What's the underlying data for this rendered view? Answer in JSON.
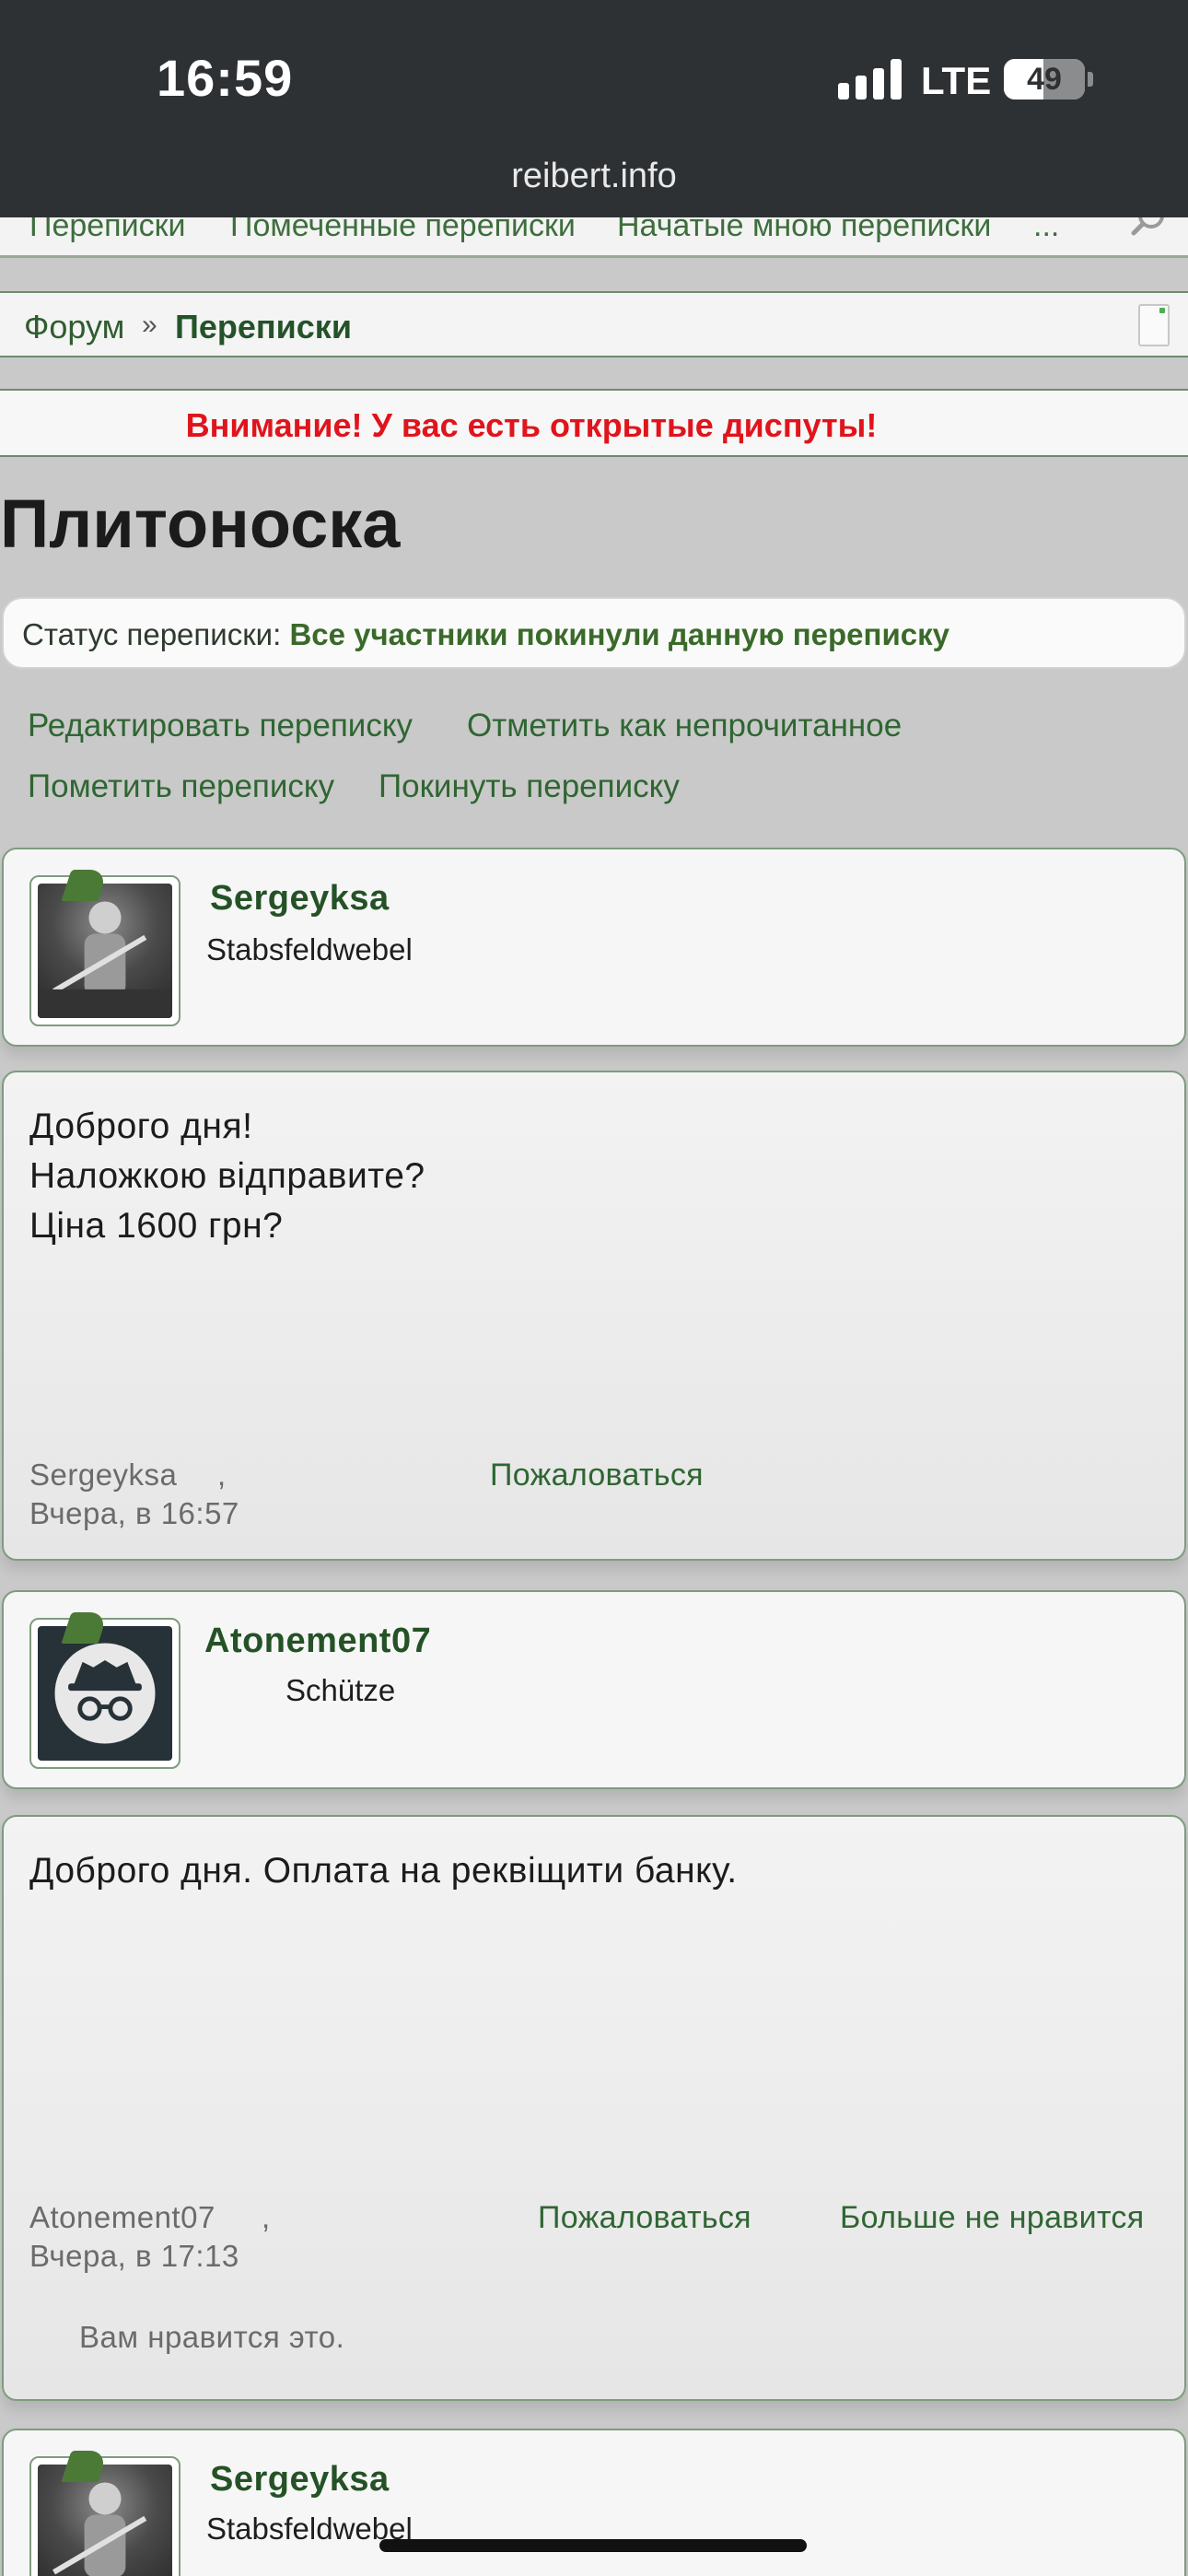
{
  "status_bar": {
    "time": "16:59",
    "network": "LTE",
    "battery": "49",
    "battery_level": 0.49
  },
  "browser": {
    "url": "reibert.info"
  },
  "top_nav": {
    "items": [
      "Переписки",
      "Помеченные переписки",
      "Начатые мною переписки",
      "..."
    ]
  },
  "breadcrumb": {
    "home": "Форум",
    "separator": "»",
    "current": "Переписки"
  },
  "notice": "Внимание! У вас есть открытые диспуты!",
  "page_title": "Плитоноска",
  "conversation_status": {
    "label": "Статус переписки:",
    "value": "Все участники покинули данную переписку"
  },
  "actions": {
    "edit": "Редактировать переписку",
    "mark_unread": "Отметить как непрочитанное",
    "star": "Пометить переписку",
    "leave": "Покинуть переписку"
  },
  "messages": [
    {
      "author": "Sergeyksa",
      "title": "Stabsfeldwebel",
      "lines": [
        "Доброго дня!",
        "Наложкою відправите?",
        "Ціна 1600 грн?"
      ],
      "meta_author": "Sergeyksa",
      "meta_comma": ",",
      "date": "Вчера, в 16:57",
      "report": "Пожаловаться"
    },
    {
      "author": "Atonement07",
      "title": "Schütze",
      "lines": [
        "Доброго дня. Оплата на реквіщити банку."
      ],
      "meta_author": "Atonement07",
      "meta_comma": ",",
      "date": "Вчера, в 17:13",
      "report": "Пожаловаться",
      "unlike": "Больше не нравится",
      "likes_text": "Вам нравится это."
    },
    {
      "author": "Sergeyksa",
      "title": "Stabsfeldwebel"
    }
  ],
  "colors": {
    "header_bg": "#2e3134",
    "link_green": "#2f6632",
    "alert_red": "#e0141c",
    "border_green": "#7e9c7e"
  }
}
